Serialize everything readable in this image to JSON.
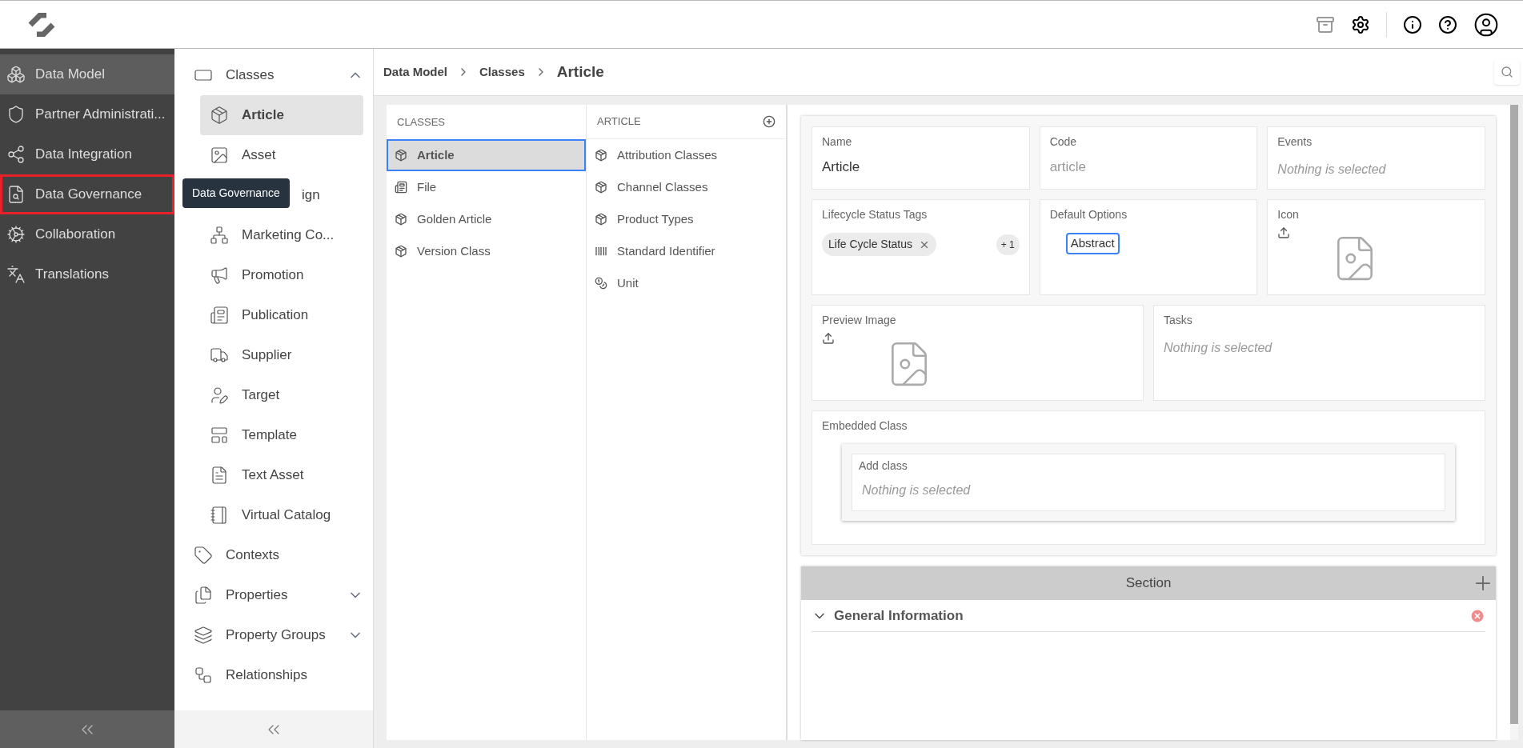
{
  "nav": {
    "items": [
      {
        "label": "Data Model",
        "selected": true,
        "outlined": false
      },
      {
        "label": "Partner Administrati...",
        "selected": false,
        "outlined": false
      },
      {
        "label": "Data Integration",
        "selected": false,
        "outlined": false
      },
      {
        "label": "Data Governance",
        "selected": false,
        "outlined": true
      },
      {
        "label": "Collaboration",
        "selected": false,
        "outlined": false
      },
      {
        "label": "Translations",
        "selected": false,
        "outlined": false
      }
    ],
    "tooltip": "Data Governance"
  },
  "tree": [
    {
      "label": "Classes",
      "expanded": true,
      "children": [
        {
          "label": "Article",
          "selected": true,
          "kind": "item"
        },
        {
          "label": "Asset",
          "selected": false,
          "kind": "item"
        },
        {
          "label": "ign",
          "kind": "covered"
        },
        {
          "label": "Marketing Co...",
          "selected": false,
          "kind": "item"
        },
        {
          "label": "Promotion",
          "selected": false,
          "kind": "item"
        },
        {
          "label": "Publication",
          "selected": false,
          "kind": "item"
        },
        {
          "label": "Supplier",
          "selected": false,
          "kind": "item"
        },
        {
          "label": "Target",
          "selected": false,
          "kind": "item"
        },
        {
          "label": "Template",
          "selected": false,
          "kind": "item"
        },
        {
          "label": "Text Asset",
          "selected": false,
          "kind": "item"
        },
        {
          "label": "Virtual Catalog",
          "selected": false,
          "kind": "item"
        }
      ]
    },
    {
      "label": "Contexts"
    },
    {
      "label": "Properties",
      "expanded": false
    },
    {
      "label": "Property Groups",
      "expanded": false
    },
    {
      "label": "Relationships"
    }
  ],
  "breadcrumb": [
    "Data Model",
    "Classes",
    "Article"
  ],
  "classes": {
    "heading": "CLASSES",
    "items": [
      {
        "label": "Article",
        "selected": true
      },
      {
        "label": "File",
        "selected": false
      },
      {
        "label": "Golden Article",
        "selected": false
      },
      {
        "label": "Version Class",
        "selected": false
      }
    ]
  },
  "article": {
    "heading": "ARTICLE",
    "items": [
      "Attribution Classes",
      "Channel Classes",
      "Product Types",
      "Standard Identifier",
      "Unit"
    ]
  },
  "form": {
    "name": {
      "label": "Name",
      "value": "Article"
    },
    "code": {
      "label": "Code",
      "value": "article"
    },
    "events": {
      "label": "Events",
      "placeholder": "Nothing is selected"
    },
    "lifecycle": {
      "label": "Lifecycle Status Tags",
      "tag": "Life Cycle Status",
      "more": "+ 1"
    },
    "default_options": {
      "label": "Default Options",
      "option": "Abstract"
    },
    "icon": {
      "label": "Icon"
    },
    "preview": {
      "label": "Preview Image"
    },
    "tasks": {
      "label": "Tasks",
      "placeholder": "Nothing is selected"
    },
    "embedded": {
      "label": "Embedded Class",
      "add_label": "Add class",
      "placeholder": "Nothing is selected"
    }
  },
  "section": {
    "title": "Section",
    "groups": [
      {
        "label": "General Information",
        "expanded": true
      }
    ]
  }
}
